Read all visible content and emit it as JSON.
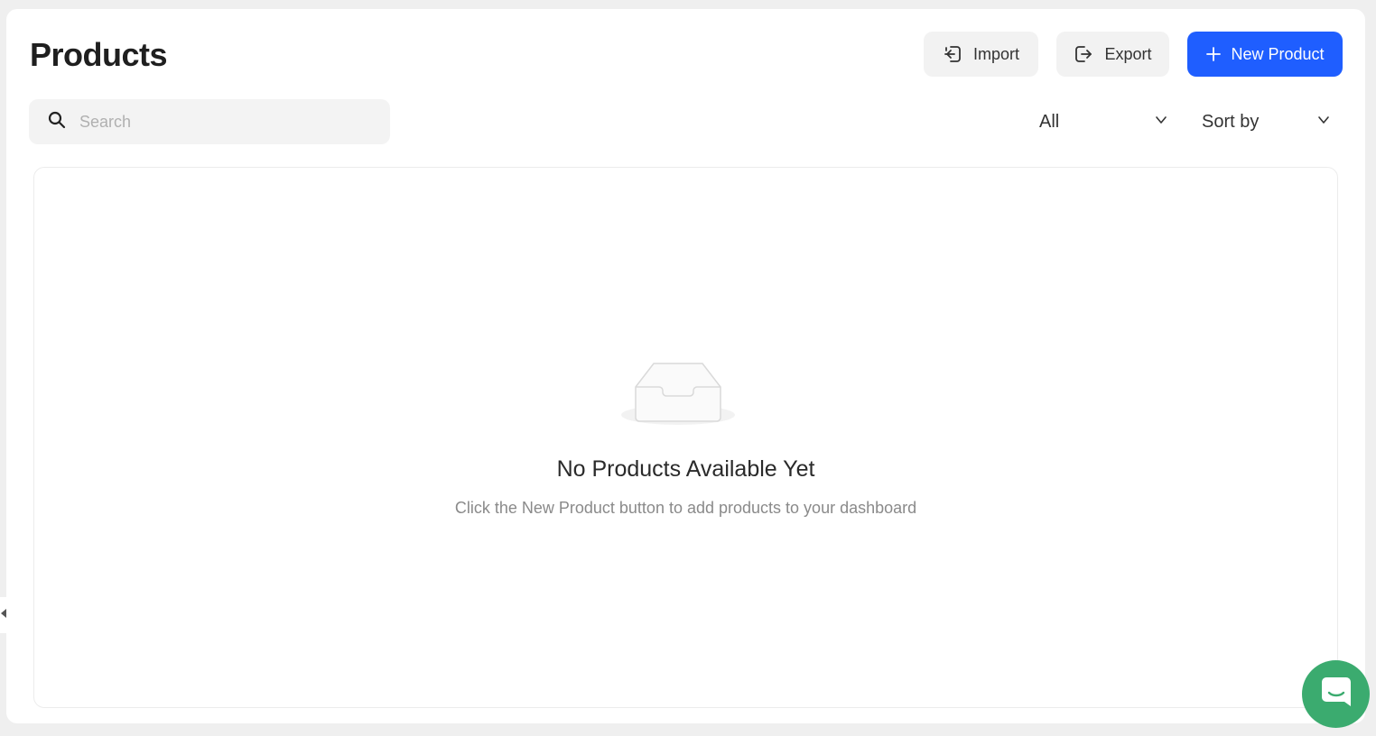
{
  "header": {
    "title": "Products",
    "import_label": "Import",
    "export_label": "Export",
    "new_product_label": "New Product"
  },
  "search": {
    "placeholder": "Search",
    "value": ""
  },
  "filters": {
    "status_selected": "All",
    "sort_selected": "Sort by"
  },
  "empty_state": {
    "title": "No Products Available Yet",
    "subtitle": "Click the New Product button to add products to your dashboard"
  },
  "icons": {
    "import": "sign-in-icon",
    "export": "sign-out-icon",
    "new": "plus-icon",
    "search": "search-icon",
    "chevron": "chevron-down-icon",
    "empty": "empty-inbox-icon",
    "chat": "chat-icon",
    "collapse": "caret-left-icon"
  },
  "colors": {
    "primary": "#1f5eff",
    "chat": "#3bab6f",
    "background": "#efefef"
  }
}
